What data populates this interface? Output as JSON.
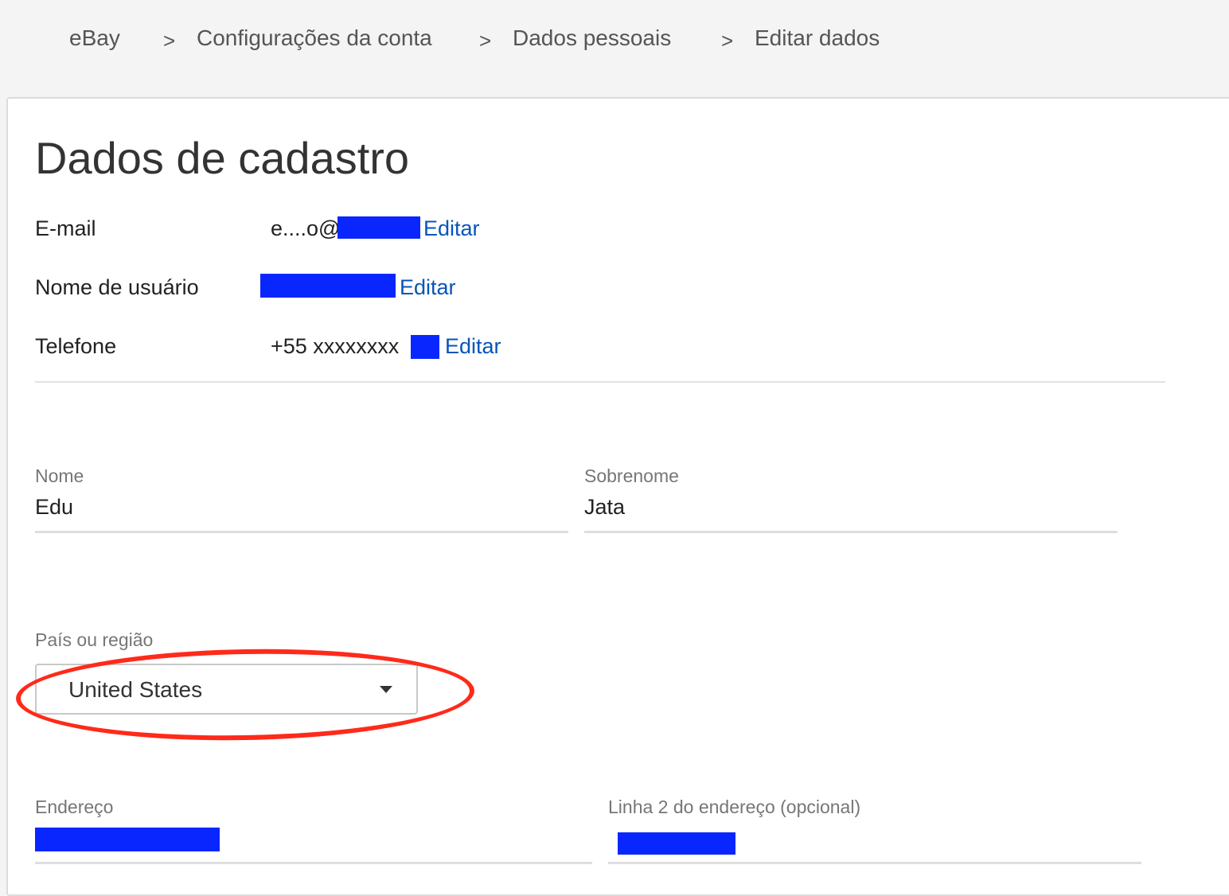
{
  "breadcrumb": {
    "items": [
      "eBay",
      "Configurações da conta",
      "Dados pessoais",
      "Editar dados"
    ],
    "separator": ">"
  },
  "page": {
    "title": "Dados de cadastro"
  },
  "account": {
    "email": {
      "label": "E-mail",
      "value": "e....o@",
      "edit_label": "Editar"
    },
    "username": {
      "label": "Nome de usuário",
      "value": "",
      "edit_label": "Editar"
    },
    "phone": {
      "label": "Telefone",
      "value": "+55 xxxxxxxx",
      "edit_label": "Editar"
    }
  },
  "form": {
    "first_name": {
      "label": "Nome",
      "value": "Edu"
    },
    "last_name": {
      "label": "Sobrenome",
      "value": "Jata"
    },
    "country": {
      "label": "País ou região",
      "selected": "United States"
    },
    "address1": {
      "label": "Endereço",
      "value": ""
    },
    "address2": {
      "label": "Linha 2 do endereço (opcional)",
      "value": ""
    }
  },
  "annotation": {
    "color": "#ff2a1a",
    "shape": "ellipse",
    "target": "country-select"
  },
  "redaction_color": "#0a26ff",
  "link_color": "#0654ba"
}
